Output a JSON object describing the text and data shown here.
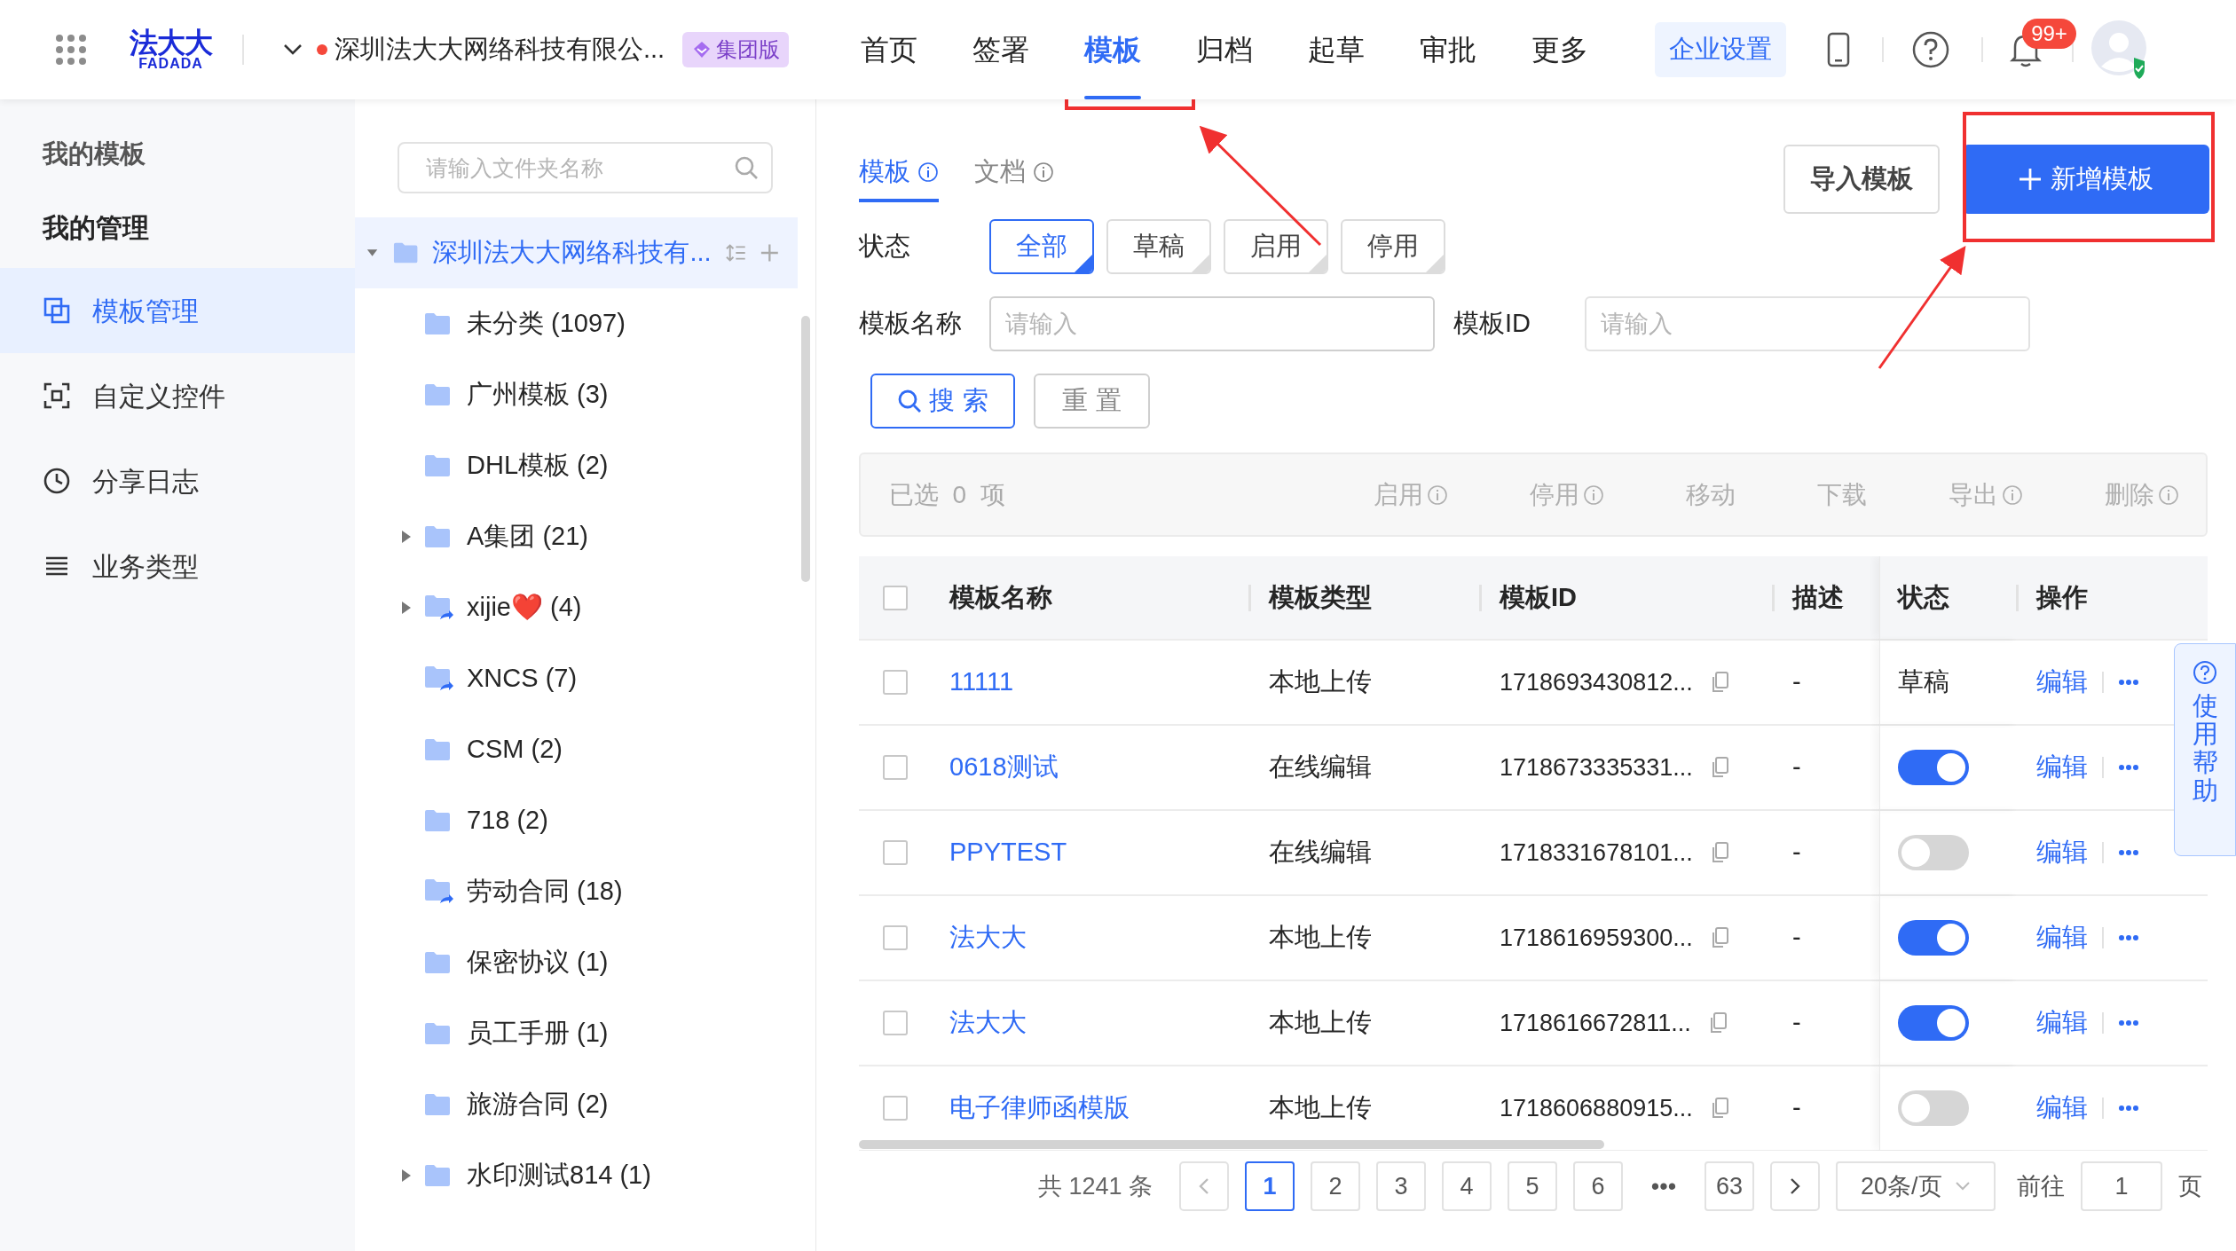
{
  "header": {
    "logo": {
      "mark": "法大大",
      "wordmark": "FADADA"
    },
    "company": "深圳法大大网络科技有限公...",
    "edition_badge": "集团版",
    "nav": [
      {
        "label": "首页",
        "selected": false
      },
      {
        "label": "签署",
        "selected": false
      },
      {
        "label": "模板",
        "selected": true
      },
      {
        "label": "归档",
        "selected": false
      },
      {
        "label": "起草",
        "selected": false
      },
      {
        "label": "审批",
        "selected": false
      },
      {
        "label": "更多",
        "selected": false
      }
    ],
    "settings_button": "企业设置",
    "notification_count": "99+"
  },
  "sidebar": {
    "title": "我的模板",
    "section": "我的管理",
    "items": [
      {
        "label": "模板管理",
        "selected": true
      },
      {
        "label": "自定义控件",
        "selected": false
      },
      {
        "label": "分享日志",
        "selected": false
      },
      {
        "label": "业务类型",
        "selected": false
      }
    ]
  },
  "folders": {
    "search": {
      "placeholder": "请输入文件夹名称"
    },
    "root": {
      "label": "深圳法大大网络科技有...",
      "selected": true,
      "expanded": true
    },
    "items": [
      {
        "label": "未分类 (1097)",
        "expandable": false,
        "shared": false
      },
      {
        "label": "广州模板 (3)",
        "expandable": false,
        "shared": false
      },
      {
        "label": "DHL模板 (2)",
        "expandable": false,
        "shared": false
      },
      {
        "label": "A集团 (21)",
        "expandable": true,
        "shared": false
      },
      {
        "label": "xijie❤️  (4)",
        "expandable": true,
        "shared": true
      },
      {
        "label": "XNCS (7)",
        "expandable": false,
        "shared": true
      },
      {
        "label": "CSM (2)",
        "expandable": false,
        "shared": false
      },
      {
        "label": "718 (2)",
        "expandable": false,
        "shared": false
      },
      {
        "label": "劳动合同 (18)",
        "expandable": false,
        "shared": true
      },
      {
        "label": "保密协议 (1)",
        "expandable": false,
        "shared": false
      },
      {
        "label": "员工手册 (1)",
        "expandable": false,
        "shared": false
      },
      {
        "label": "旅游合同 (2)",
        "expandable": false,
        "shared": false
      },
      {
        "label": "水印测试814 (1)",
        "expandable": true,
        "shared": false
      }
    ]
  },
  "main": {
    "tabs": [
      {
        "label": "模板",
        "selected": true
      },
      {
        "label": "文档",
        "selected": false
      }
    ],
    "import_button": "导入模板",
    "new_button": "新增模板",
    "filters": {
      "status_label": "状态",
      "chips": [
        {
          "label": "全部",
          "selected": true
        },
        {
          "label": "草稿",
          "selected": false
        },
        {
          "label": "启用",
          "selected": false
        },
        {
          "label": "停用",
          "selected": false
        }
      ],
      "name_label": "模板名称",
      "name_placeholder": "请输入",
      "id_label": "模板ID",
      "id_placeholder": "请输入",
      "search_button": "搜 索",
      "reset_button": "重 置"
    },
    "batch": {
      "selected_text": "已选  0  项",
      "actions": [
        {
          "label": "启用",
          "info": true
        },
        {
          "label": "停用",
          "info": true
        },
        {
          "label": "移动",
          "info": false
        },
        {
          "label": "下载",
          "info": false
        },
        {
          "label": "导出",
          "info": true
        },
        {
          "label": "删除",
          "info": true
        }
      ]
    },
    "table": {
      "all_checked": false,
      "columns": [
        "模板名称",
        "模板类型",
        "模板ID",
        "描述",
        "状态",
        "操作"
      ],
      "rows": [
        {
          "name": "11111",
          "type": "本地上传",
          "id": "1718693430812...",
          "description": "-",
          "status": {
            "kind": "text",
            "text": "草稿"
          },
          "action": "编辑",
          "checked": false
        },
        {
          "name": "0618测试",
          "type": "在线编辑",
          "id": "1718673335331...",
          "description": "-",
          "status": {
            "kind": "switch",
            "on": true
          },
          "action": "编辑",
          "checked": false
        },
        {
          "name": "PPYTEST",
          "type": "在线编辑",
          "id": "1718331678101...",
          "description": "-",
          "status": {
            "kind": "switch",
            "on": false
          },
          "action": "编辑",
          "checked": false
        },
        {
          "name": "法大大",
          "type": "本地上传",
          "id": "1718616959300...",
          "description": "-",
          "status": {
            "kind": "switch",
            "on": true
          },
          "action": "编辑",
          "checked": false
        },
        {
          "name": "法大大",
          "type": "本地上传",
          "id": "1718616672811...",
          "description": "-",
          "status": {
            "kind": "switch",
            "on": true
          },
          "action": "编辑",
          "checked": false
        },
        {
          "name": "电子律师函模版",
          "type": "本地上传",
          "id": "1718606880915...",
          "description": "-",
          "status": {
            "kind": "switch",
            "on": false
          },
          "action": "编辑",
          "checked": false
        }
      ]
    },
    "pagination": {
      "total": "共 1241 条",
      "pages": [
        {
          "label": "1",
          "selected": true
        },
        {
          "label": "2",
          "selected": false
        },
        {
          "label": "3",
          "selected": false
        },
        {
          "label": "4",
          "selected": false
        },
        {
          "label": "5",
          "selected": false
        },
        {
          "label": "6",
          "selected": false
        },
        {
          "label": "•••",
          "selected": false
        },
        {
          "label": "63",
          "selected": false
        }
      ],
      "page_size": "20条/页",
      "goto_label": "前往",
      "goto_value": "1",
      "goto_suffix": "页"
    }
  },
  "help_tab": "使用帮助"
}
